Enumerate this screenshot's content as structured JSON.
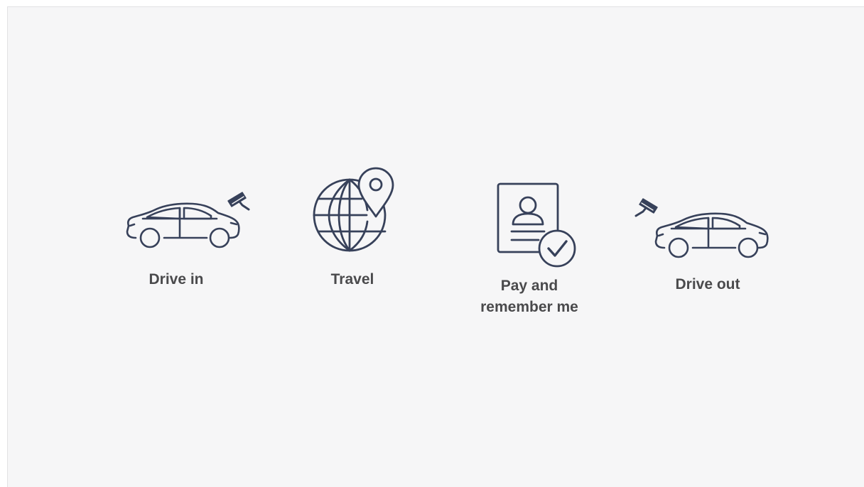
{
  "colors": {
    "icon_stroke": "#37415a",
    "label_text": "#4a4a4c",
    "background": "#f6f6f7"
  },
  "steps": [
    {
      "label": "Drive in",
      "icons": [
        "car-icon",
        "security-camera-icon"
      ]
    },
    {
      "label": "Travel",
      "icons": [
        "globe-icon",
        "map-pin-icon"
      ]
    },
    {
      "label_line1": "Pay and",
      "label_line2": "remember me",
      "icons": [
        "id-document-icon",
        "checkmark-badge-icon"
      ]
    },
    {
      "label": "Drive out",
      "icons": [
        "security-camera-icon",
        "car-icon"
      ]
    }
  ]
}
